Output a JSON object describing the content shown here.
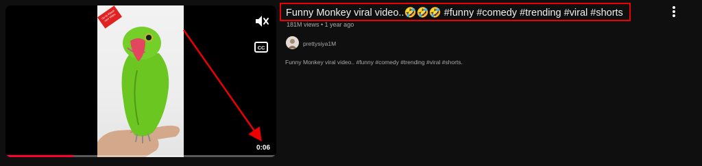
{
  "player": {
    "time": "0:06",
    "progress": 0.25,
    "thumbnail_badge": "Go to Watch new Video",
    "mute_icon": "volume-off-icon",
    "cc_icon": "closed-captions-icon"
  },
  "video": {
    "title": "Funny Monkey viral video..🤣🤣🤣 #funny #comedy #trending #viral #shorts",
    "meta": "181M views • 1 year ago",
    "channel": "prettysiya1M",
    "description": "Funny Monkey viral video.. #funny #comedy #trending #viral #shorts."
  },
  "colors": {
    "background": "#0f0f0f",
    "annotation": "#e00000",
    "progress": "#ff0033",
    "parrot": "#5fbf1c"
  }
}
